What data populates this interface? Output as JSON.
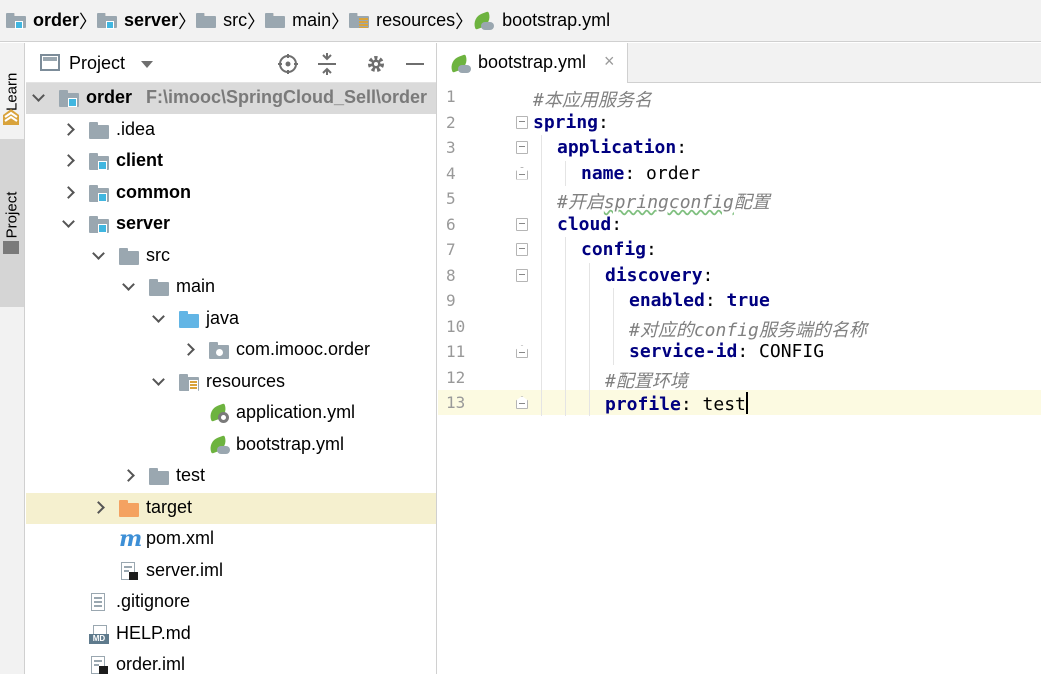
{
  "breadcrumb": [
    {
      "label": "order",
      "bold": true,
      "icon": "module-folder-icon"
    },
    {
      "label": "server",
      "bold": true,
      "icon": "module-folder-icon"
    },
    {
      "label": "src",
      "bold": false,
      "icon": "folder-icon"
    },
    {
      "label": "main",
      "bold": false,
      "icon": "folder-icon"
    },
    {
      "label": "resources",
      "bold": false,
      "icon": "resources-folder-icon"
    },
    {
      "label": "bootstrap.yml",
      "bold": false,
      "icon": "spring-config-icon"
    }
  ],
  "tool_stripe": {
    "learn_label": "Learn",
    "project_label": "1: Project"
  },
  "project_panel": {
    "title": "Project",
    "tree": [
      {
        "label": "order",
        "path": "F:\\imooc\\SpringCloud_Sell\\order",
        "bold": true,
        "depth": 0,
        "arrow": "down",
        "icon": "module",
        "root": true
      },
      {
        "label": ".idea",
        "depth": 1,
        "arrow": "right",
        "icon": "folder"
      },
      {
        "label": "client",
        "bold": true,
        "depth": 1,
        "arrow": "right",
        "icon": "module"
      },
      {
        "label": "common",
        "bold": true,
        "depth": 1,
        "arrow": "right",
        "icon": "module"
      },
      {
        "label": "server",
        "bold": true,
        "depth": 1,
        "arrow": "down",
        "icon": "module"
      },
      {
        "label": "src",
        "depth": 2,
        "arrow": "down",
        "icon": "folder"
      },
      {
        "label": "main",
        "depth": 3,
        "arrow": "down",
        "icon": "folder"
      },
      {
        "label": "java",
        "depth": 4,
        "arrow": "down",
        "icon": "source"
      },
      {
        "label": "com.imooc.order",
        "depth": 5,
        "arrow": "right",
        "icon": "package"
      },
      {
        "label": "resources",
        "depth": 4,
        "arrow": "down",
        "icon": "resources"
      },
      {
        "label": "application.yml",
        "depth": 5,
        "arrow": "none",
        "icon": "spring-gear"
      },
      {
        "label": "bootstrap.yml",
        "depth": 5,
        "arrow": "none",
        "icon": "spring-cloud"
      },
      {
        "label": "test",
        "depth": 3,
        "arrow": "right",
        "icon": "folder"
      },
      {
        "label": "target",
        "depth": 2,
        "arrow": "right",
        "icon": "excluded",
        "selected": true
      },
      {
        "label": "pom.xml",
        "depth": 2,
        "arrow": "none",
        "icon": "maven"
      },
      {
        "label": "server.iml",
        "depth": 2,
        "arrow": "none",
        "icon": "iml"
      },
      {
        "label": ".gitignore",
        "depth": 1,
        "arrow": "none",
        "icon": "text"
      },
      {
        "label": "HELP.md",
        "depth": 1,
        "arrow": "none",
        "icon": "markdown"
      },
      {
        "label": "order.iml",
        "depth": 1,
        "arrow": "none",
        "icon": "iml"
      }
    ]
  },
  "editor": {
    "tab_label": "bootstrap.yml",
    "tab_close": "×",
    "current_line": 13,
    "lines": [
      {
        "n": "1",
        "fold": "",
        "indent": 0,
        "parts": [
          {
            "t": "#本应用服务名",
            "c": "cm"
          }
        ]
      },
      {
        "n": "2",
        "fold": "open",
        "indent": 0,
        "parts": [
          {
            "t": "spring",
            "c": "kw"
          },
          {
            "t": ":",
            "c": "val"
          }
        ]
      },
      {
        "n": "3",
        "fold": "open",
        "indent": 1,
        "parts": [
          {
            "t": "application",
            "c": "kw"
          },
          {
            "t": ":",
            "c": "val"
          }
        ]
      },
      {
        "n": "4",
        "fold": "close",
        "indent": 2,
        "parts": [
          {
            "t": "name",
            "c": "kw"
          },
          {
            "t": ": order",
            "c": "val"
          }
        ]
      },
      {
        "n": "5",
        "fold": "",
        "indent": 1,
        "parts": [
          {
            "t": "#开启",
            "c": "cm"
          },
          {
            "t": "springconfig",
            "c": "cm squig"
          },
          {
            "t": "配置",
            "c": "cm"
          }
        ]
      },
      {
        "n": "6",
        "fold": "open",
        "indent": 1,
        "parts": [
          {
            "t": "cloud",
            "c": "kw"
          },
          {
            "t": ":",
            "c": "val"
          }
        ]
      },
      {
        "n": "7",
        "fold": "open",
        "indent": 2,
        "parts": [
          {
            "t": "config",
            "c": "kw"
          },
          {
            "t": ":",
            "c": "val"
          }
        ]
      },
      {
        "n": "8",
        "fold": "open",
        "indent": 3,
        "parts": [
          {
            "t": "discovery",
            "c": "kw"
          },
          {
            "t": ":",
            "c": "val"
          }
        ]
      },
      {
        "n": "9",
        "fold": "",
        "indent": 4,
        "parts": [
          {
            "t": "enabled",
            "c": "kw"
          },
          {
            "t": ": ",
            "c": "val"
          },
          {
            "t": "true",
            "c": "bool"
          }
        ]
      },
      {
        "n": "10",
        "fold": "",
        "indent": 4,
        "parts": [
          {
            "t": "#对应的config服务端的名称",
            "c": "cm"
          }
        ]
      },
      {
        "n": "11",
        "fold": "close",
        "indent": 4,
        "parts": [
          {
            "t": "service-id",
            "c": "kw"
          },
          {
            "t": ": CONFIG",
            "c": "val"
          }
        ]
      },
      {
        "n": "12",
        "fold": "",
        "indent": 3,
        "parts": [
          {
            "t": "#配置环境",
            "c": "cm"
          }
        ]
      },
      {
        "n": "13",
        "fold": "close",
        "indent": 3,
        "parts": [
          {
            "t": "profile",
            "c": "kw"
          },
          {
            "t": ": test",
            "c": "val"
          }
        ],
        "caret": true
      }
    ]
  }
}
